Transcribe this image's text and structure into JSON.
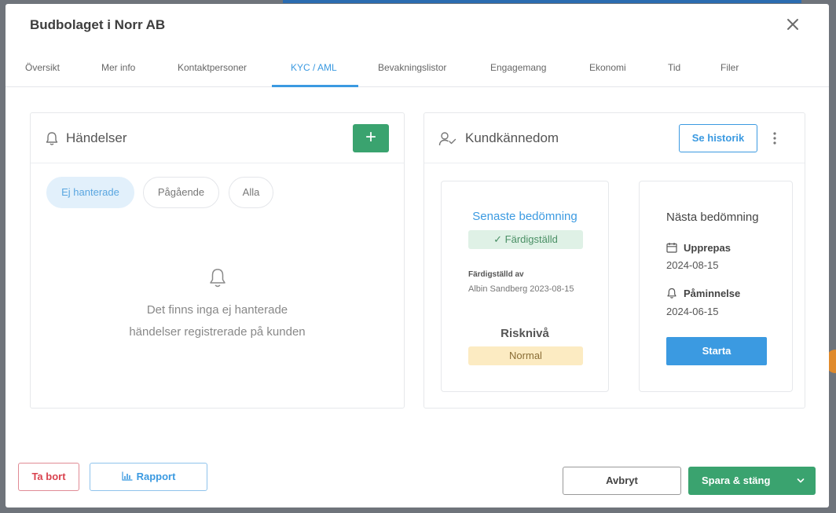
{
  "modal": {
    "title": "Budbolaget i Norr AB"
  },
  "tabs": [
    {
      "label": "Översikt"
    },
    {
      "label": "Mer info"
    },
    {
      "label": "Kontaktpersoner"
    },
    {
      "label": "KYC / AML",
      "active": true
    },
    {
      "label": "Bevakningslistor"
    },
    {
      "label": "Engagemang"
    },
    {
      "label": "Ekonomi"
    },
    {
      "label": "Tid"
    },
    {
      "label": "Filer"
    }
  ],
  "events": {
    "title": "Händelser",
    "add_label": "+",
    "filters": [
      {
        "label": "Ej hanterade",
        "active": true
      },
      {
        "label": "Pågående"
      },
      {
        "label": "Alla"
      }
    ],
    "empty_line1": "Det finns inga ej hanterade",
    "empty_line2": "händelser registrerade på kunden"
  },
  "kyc": {
    "title": "Kundkännedom",
    "history_label": "Se historik",
    "latest": {
      "title": "Senaste bedömning",
      "status": "✓  Färdigställd",
      "completed_by_label": "Färdigställd av",
      "completed_by_value": "Albin Sandberg 2023-08-15",
      "risk_title": "Risknivå",
      "risk_value": "Normal"
    },
    "next": {
      "title": "Nästa bedömning",
      "repeat_label": "Upprepas",
      "repeat_date": "2024-08-15",
      "reminder_label": "Påminnelse",
      "reminder_date": "2024-06-15",
      "start_label": "Starta"
    }
  },
  "footer": {
    "delete_label": "Ta bort",
    "report_label": "Rapport",
    "cancel_label": "Avbryt",
    "save_label": "Spara & stäng"
  },
  "icons": {
    "close": "close-icon",
    "bell": "bell-icon",
    "user_check": "user-check-icon",
    "kebab": "more-vertical-icon",
    "calendar": "calendar-icon",
    "chevron": "chevron-down-icon",
    "chart": "chart-icon"
  },
  "colors": {
    "primary": "#3b9ae1",
    "success": "#3aa36f",
    "danger": "#d9434f",
    "warning_bg": "#fcebc2"
  }
}
